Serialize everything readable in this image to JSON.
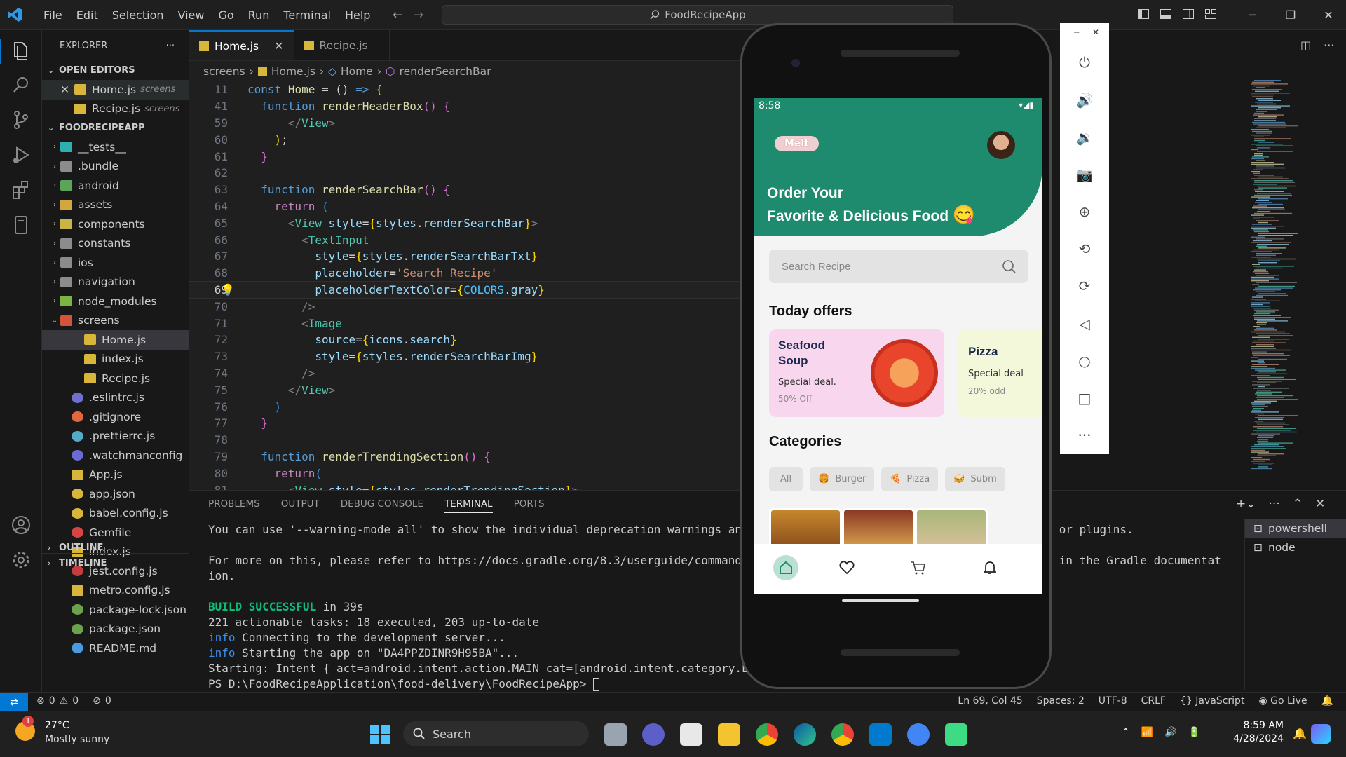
{
  "titlebar": {
    "menu": [
      "File",
      "Edit",
      "Selection",
      "View",
      "Go",
      "Run",
      "Terminal",
      "Help"
    ],
    "search": "FoodRecipeApp"
  },
  "sidebar": {
    "title": "EXPLORER",
    "open_editors": "OPEN EDITORS",
    "project": "FOODRECIPEAPP",
    "outline": "OUTLINE",
    "timeline": "TIMELINE",
    "open": [
      {
        "name": "Home.js",
        "sub": "screens"
      },
      {
        "name": "Recipe.js",
        "sub": "screens"
      }
    ],
    "tree": [
      "__tests__",
      ".bundle",
      "android",
      "assets",
      "components",
      "constants",
      "ios",
      "navigation",
      "node_modules",
      "screens",
      "Home.js",
      "index.js",
      "Recipe.js",
      ".eslintrc.js",
      ".gitignore",
      ".prettierrc.js",
      ".watchmanconfig",
      "App.js",
      "app.json",
      "babel.config.js",
      "Gemfile",
      "index.js",
      "jest.config.js",
      "metro.config.js",
      "package-lock.json",
      "package.json",
      "README.md"
    ]
  },
  "editor": {
    "tabs": [
      "Home.js",
      "Recipe.js"
    ],
    "breadcrumb": [
      "screens",
      "Home.js",
      "Home",
      "renderSearchBar"
    ],
    "lines": [
      "11",
      "41",
      "59",
      "60",
      "61",
      "62",
      "63",
      "64",
      "65",
      "66",
      "67",
      "68",
      "69",
      "70",
      "71",
      "72",
      "73",
      "74",
      "75",
      "76",
      "77",
      "78",
      "79",
      "80",
      "81"
    ]
  },
  "panel": {
    "tabs": [
      "PROBLEMS",
      "OUTPUT",
      "DEBUG CONSOLE",
      "TERMINAL",
      "PORTS"
    ],
    "term": {
      "l1": "You can use '--warning-mode all' to show the individual deprecation warnings and determine if they come from your own scripts or plugins.",
      "l2": "For more on this, please refer to https://docs.gradle.org/8.3/userguide/command_line_interface.html#sec:command_line_warnings in the Gradle documentat",
      "l3": "ion.",
      "build_a": "BUILD SUCCESSFUL",
      "build_b": " in 39s",
      "l5": "221 actionable tasks: 18 executed, 203 up-to-date",
      "info": "info",
      "l6": " Connecting to the development server...",
      "l7": " Starting the app on \"DA4PPZDINR9H95BA\"...",
      "l8": "Starting: Intent { act=android.intent.action.MAIN cat=[android.intent.category.LAUNCHER] }",
      "l9": "PS D:\\FoodRecipeApplication\\food-delivery\\FoodRecipeApp> "
    },
    "terminals": [
      "powershell",
      "node"
    ]
  },
  "status": {
    "errors": "0",
    "warnings": "0",
    "ports": "0",
    "position": "Ln 69, Col 45",
    "spaces": "Spaces: 2",
    "encoding": "UTF-8",
    "eol": "CRLF",
    "lang": "JavaScript",
    "golive": "Go Live"
  },
  "taskbar": {
    "temp": "27°C",
    "weather": "Mostly sunny",
    "search": "Search",
    "time": "8:59 AM",
    "date": "4/28/2024",
    "badge": "1"
  },
  "phone": {
    "time": "8:58",
    "pill": "Melt",
    "headline1": "Order Your",
    "headline2": "Favorite & Delicious Food",
    "emoji": "😋",
    "search": "Search Recipe",
    "offers_title": "Today offers",
    "offer1": {
      "title": "Seafood Soup",
      "sub": "Special deal.",
      "off": "50% Off"
    },
    "offer2": {
      "title": "Pizza",
      "sub": "Special deal",
      "off": "20% odd"
    },
    "categories_title": "Categories",
    "categories": [
      "All",
      "Burger",
      "Pizza",
      "Subm"
    ]
  },
  "colors": {
    "accent": "#0078d4",
    "app_green": "#1e8b6f"
  }
}
